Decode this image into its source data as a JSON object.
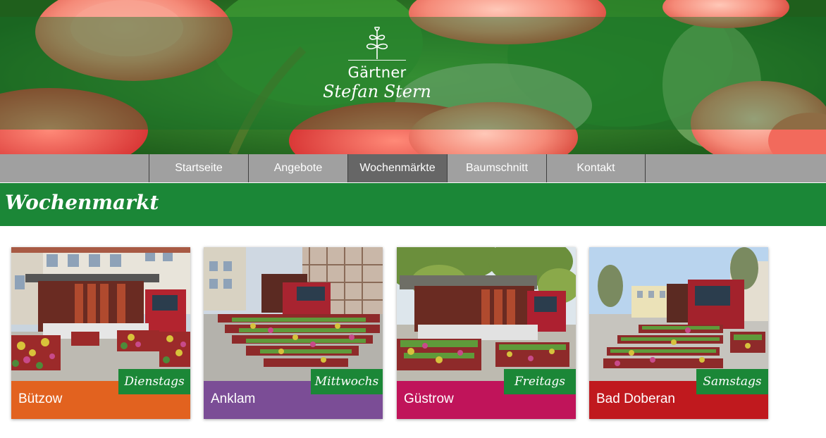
{
  "brand": {
    "line1": "Gärtner",
    "line2": "Stefan Stern",
    "logo_icon": "plant-sprout-icon"
  },
  "nav": {
    "items": [
      {
        "label": "Startseite",
        "active": false
      },
      {
        "label": "Angebote",
        "active": false
      },
      {
        "label": "Wochenmärkte",
        "active": true
      },
      {
        "label": "Baumschnitt",
        "active": false
      },
      {
        "label": "Kontakt",
        "active": false
      }
    ]
  },
  "page": {
    "title": "Wochenmarkt"
  },
  "markets": [
    {
      "town": "Bützow",
      "day": "Dienstags",
      "color": "#e2621f"
    },
    {
      "town": "Anklam",
      "day": "Mittwochs",
      "color": "#7b4d96"
    },
    {
      "town": "Güstrow",
      "day": "Freitags",
      "color": "#c0145a"
    },
    {
      "town": "Bad Doberan",
      "day": "Samstags",
      "color": "#c0191e"
    }
  ],
  "colors": {
    "brand_green": "#1b8737",
    "nav_gray": "#a0a0a0",
    "nav_active": "#666666"
  }
}
